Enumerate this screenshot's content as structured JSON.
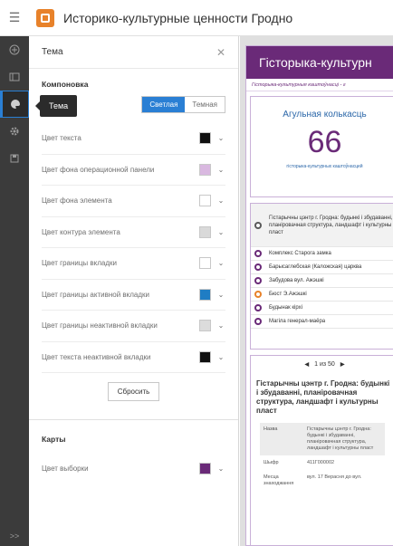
{
  "header": {
    "title": "Историко-культурные ценности Гродно"
  },
  "tooltip": {
    "text": "Тема"
  },
  "panel": {
    "title": "Тема",
    "section_layout": "Компоновка",
    "mode_light": "Светлая",
    "mode_dark": "Темная",
    "colors": [
      {
        "label": "Цвет текста",
        "color": "#111111"
      },
      {
        "label": "Цвет фона операционной панели",
        "color": "#d9b8e0"
      },
      {
        "label": "Цвет фона элемента",
        "color": "#ffffff"
      },
      {
        "label": "Цвет контура элемента",
        "color": "#d9d9d9"
      },
      {
        "label": "Цвет границы вкладки",
        "color": "#ffffff"
      },
      {
        "label": "Цвет границы активной вкладки",
        "color": "#1f7dc4"
      },
      {
        "label": "Цвет границы неактивной вкладки",
        "color": "#dcdcdc"
      },
      {
        "label": "Цвет текста неактивной вкладки",
        "color": "#111111"
      }
    ],
    "reset_label": "Сбросить",
    "section_maps": "Карты",
    "selection_color": {
      "label": "Цвет выборки",
      "color": "#6a2a78"
    }
  },
  "preview": {
    "title": "Гісторыка-культурн",
    "subtitle": "Гісторыка-культурныя каштоўнасці - г",
    "count_title": "Агульная колькасць",
    "count_value": "66",
    "count_caption": "гісторыка-культурных каштоўнасцей",
    "list": [
      {
        "text": "Гістарычны цэнтр г. Гродна: будынкі і збудаванні, планіровачная структура, ландшафт і культурны пласт",
        "dot": "gray"
      },
      {
        "text": "Комплекс Старога замка",
        "dot": "purple"
      },
      {
        "text": "Барысаглебская (Каложская) царква",
        "dot": "purple"
      },
      {
        "text": "Забудова вул. Ажэшкі",
        "dot": "purple"
      },
      {
        "text": "Бюст Э.Ажэшкі",
        "dot": "orange"
      },
      {
        "text": "Будынак кірхі",
        "dot": "purple"
      },
      {
        "text": "Магіла генерал-маёра",
        "dot": "purple"
      }
    ],
    "pager": "1 из 50",
    "detail_title": "Гістарычны цэнтр г. Гродна: будынкі і збудаванні, планіровачная структура, ландшафт і культурны пласт",
    "detail_rows": [
      {
        "key": "Назва",
        "value": "Гістарычны цэнтр г. Гродна: будынкі і збудаванні, планіровачная структура, ландшафт і культурны пласт"
      },
      {
        "key": "Шыфр",
        "value": "411Г000002"
      },
      {
        "key": "Месца знаходжання",
        "value": "вул. 17 Верасня до вул."
      }
    ]
  }
}
